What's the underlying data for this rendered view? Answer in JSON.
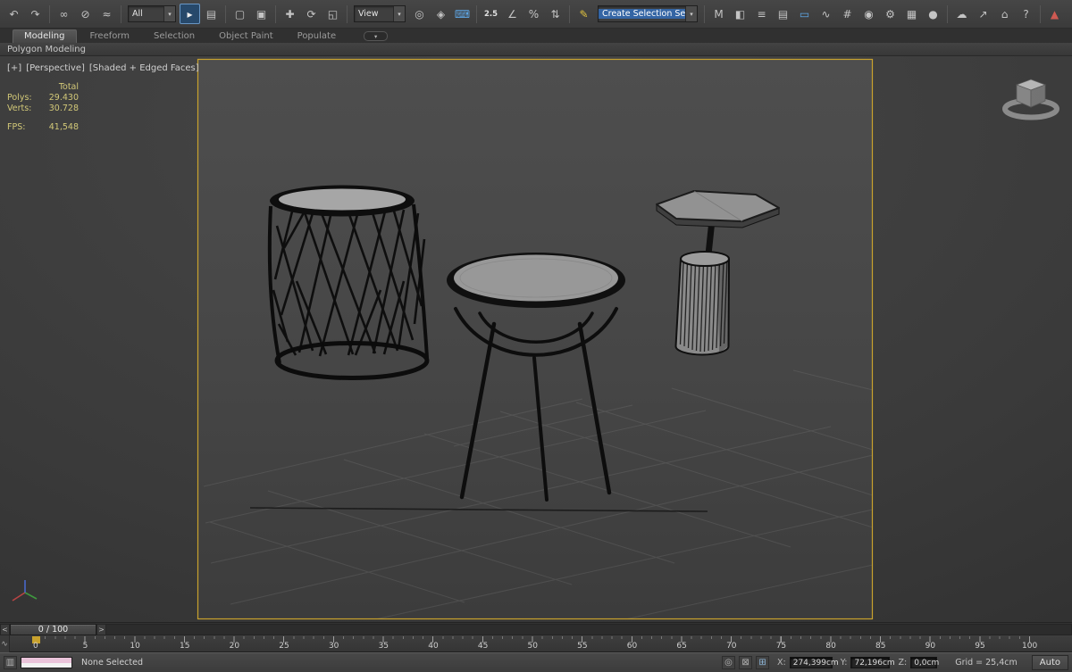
{
  "colors": {
    "safe_frame": "#c9a22d",
    "stats_text": "#d2c878",
    "active_tool_highlight": "#27496b",
    "accent_blue": "#5fa8e8"
  },
  "toolbar": {
    "undo": "↶",
    "redo": "↷",
    "select_link": "∞",
    "unlink": "⊘",
    "bind_spacewarp": "≈",
    "filter_value": "All",
    "select_object": "▸",
    "select_by_name": "▤",
    "region_select": "▢",
    "window_crossing": "▣",
    "move": "✚",
    "rotate": "⟳",
    "scale": "◱",
    "coord_value": "View",
    "pivot_center": "◎",
    "manipulate": "◈",
    "keyboard_override": "⌨",
    "snap_25": "2.5",
    "angle_snap": "∠",
    "percent_snap": "%",
    "spinner_snap": "⇅",
    "edit_sel_sets": "✎",
    "selection_set_value": "Create Selection Se",
    "mirror": "M",
    "align": "◧",
    "layer_manager": "≡",
    "scene_explorer": "▤",
    "ribbon_toggle": "▭",
    "curve_editor": "∿",
    "schematic_view": "#",
    "material_editor": "◉",
    "render_setup": "⚙",
    "rendered_frame": "▦",
    "render_production": "●",
    "cloud_render": "☁",
    "share_view": "↗",
    "asset_library": "⌂",
    "help_community": "?",
    "civil_view": "▲",
    "measure_ruler": "╍",
    "snowflake_gear": "❄",
    "dropdown_arrow": "▾"
  },
  "ribbon": {
    "tab_modeling": "Modeling",
    "tab_freeform": "Freeform",
    "tab_selection": "Selection",
    "tab_object_paint": "Object Paint",
    "tab_populate": "Populate",
    "collapse": "▾"
  },
  "panel_bar": {
    "title": "Polygon Modeling"
  },
  "viewport": {
    "menu_plus": "[+]",
    "menu_pov": "[Perspective]",
    "menu_shading": "[Shaded + Edged Faces]",
    "stats": {
      "total_label": "Total",
      "polys_label": "Polys:",
      "polys": "29.430",
      "verts_label": "Verts:",
      "verts": "30.728",
      "fps_label": "FPS:",
      "fps": "41,548"
    }
  },
  "timeline": {
    "prev": "<",
    "next": ">",
    "range_label": "0 / 100",
    "curve_editor_glyph": "∿",
    "ticks": [
      "0",
      "5",
      "10",
      "15",
      "20",
      "25",
      "30",
      "35",
      "40",
      "45",
      "50",
      "55",
      "60",
      "65",
      "70",
      "75",
      "80",
      "85",
      "90",
      "95",
      "100"
    ]
  },
  "statusbar": {
    "listener_icon_glyph": "▥",
    "selection_status": "None Selected",
    "isolate_glyph": "◎",
    "lock_glyph": "⊠",
    "absolute_glyph": "⊞",
    "x_label": "X:",
    "x_value": "274,399cm",
    "y_label": "Y:",
    "y_value": "72,196cm",
    "z_label": "Z:",
    "z_value": "0,0cm",
    "grid_label": "Grid = 25,4cm",
    "autokey_label": "Auto"
  }
}
